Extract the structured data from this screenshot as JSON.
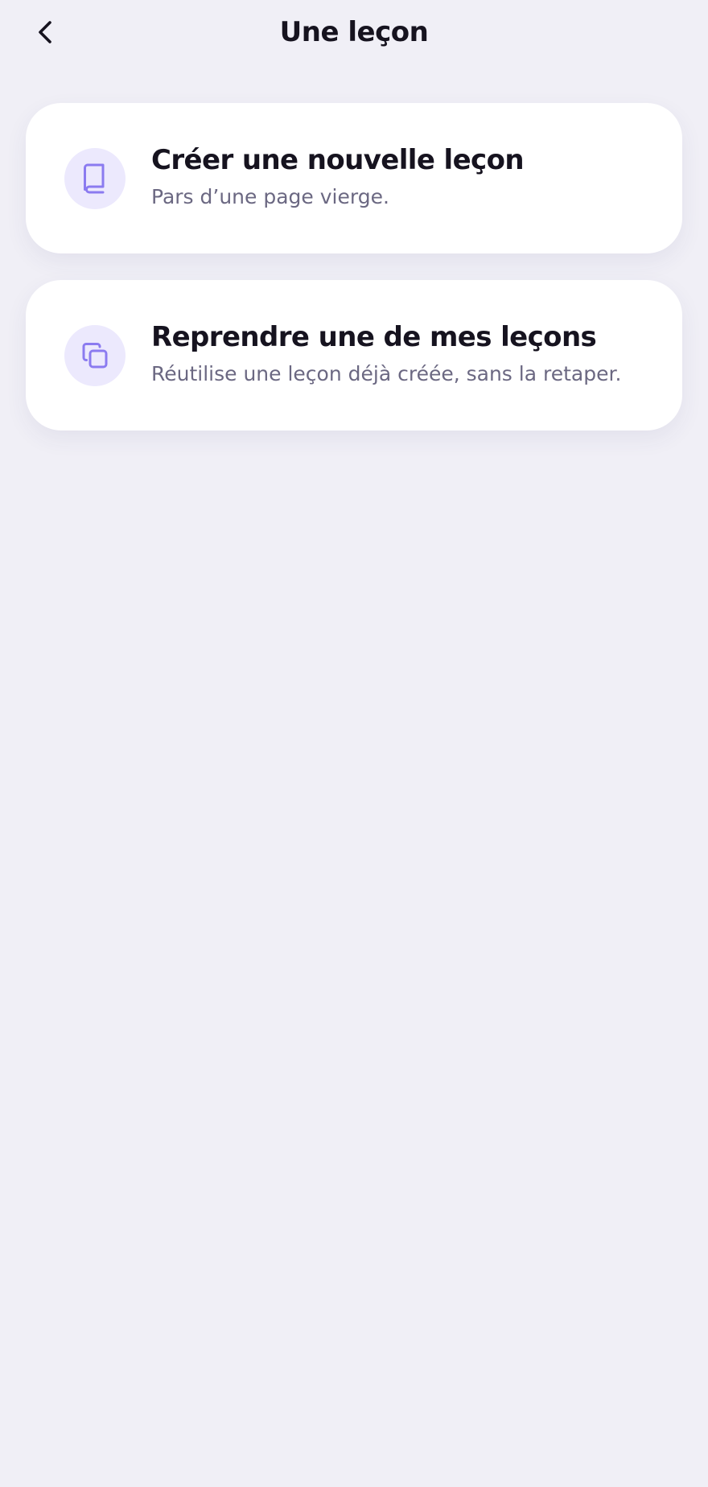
{
  "header": {
    "title": "Une leçon",
    "back_icon": "chevron-left-icon"
  },
  "options": [
    {
      "title": "Créer une nouvelle leçon",
      "subtitle": "Pars d’une page vierge.",
      "icon": "book-icon"
    },
    {
      "title": "Reprendre une de mes leçons",
      "subtitle": "Réutilise une leçon déjà créée, sans la retaper.",
      "icon": "copy-icon"
    }
  ],
  "colors": {
    "background": "#F0EFF6",
    "card": "#FFFFFF",
    "accent": "#8B7BF0",
    "icon_bg": "#ECE9FD",
    "title_text": "#16131F",
    "subtitle_text": "#6B6882"
  }
}
